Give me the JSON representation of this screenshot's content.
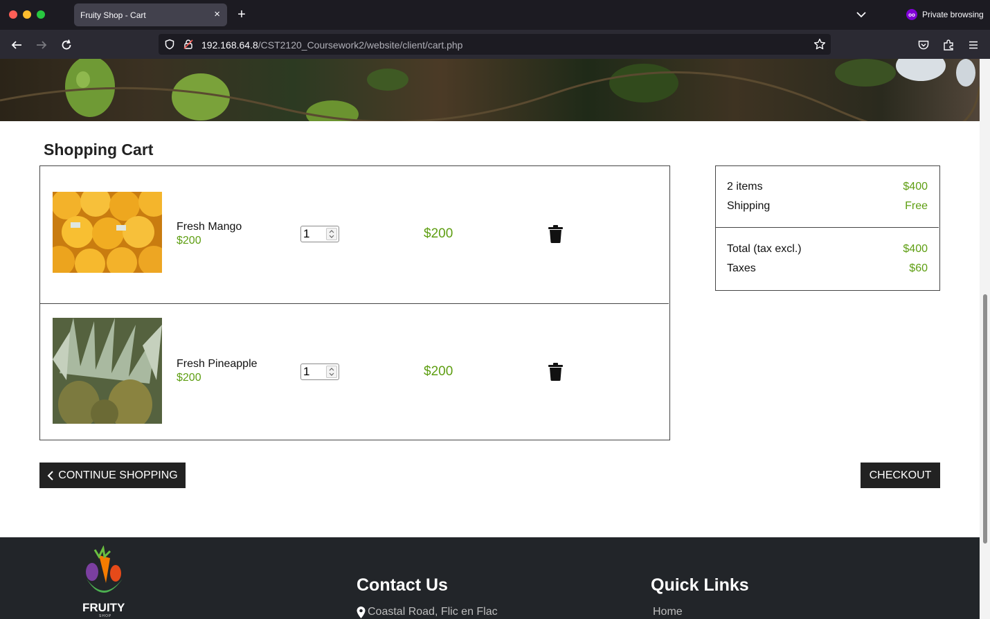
{
  "browser": {
    "tab_title": "Fruity Shop - Cart",
    "private_label": "Private browsing",
    "url_host": "192.168.64.8",
    "url_path": "/CST2120_Coursework2/website/client/cart.php"
  },
  "cart": {
    "title": "Shopping Cart",
    "items": [
      {
        "name": "Fresh Mango",
        "unit_price": "$200",
        "quantity": "1",
        "line_total": "$200"
      },
      {
        "name": "Fresh Pineapple",
        "unit_price": "$200",
        "quantity": "1",
        "line_total": "$200"
      }
    ]
  },
  "summary": {
    "items_label": "2 items",
    "items_value": "$400",
    "shipping_label": "Shipping",
    "shipping_value": "Free",
    "total_label": "Total (tax excl.)",
    "total_value": "$400",
    "taxes_label": "Taxes",
    "taxes_value": "$60"
  },
  "actions": {
    "continue_label": "CONTINUE SHOPPING",
    "checkout_label": "CHECKOUT"
  },
  "footer": {
    "logo_text": "FRUITY",
    "logo_sub": "SHOP",
    "contact_heading": "Contact Us",
    "address": "Coastal Road, Flic en Flac",
    "quick_heading": "Quick Links",
    "home_link": "Home"
  },
  "colors": {
    "accent_green": "#5e9e12",
    "button_dark": "#222222",
    "footer_bg": "#222529"
  }
}
